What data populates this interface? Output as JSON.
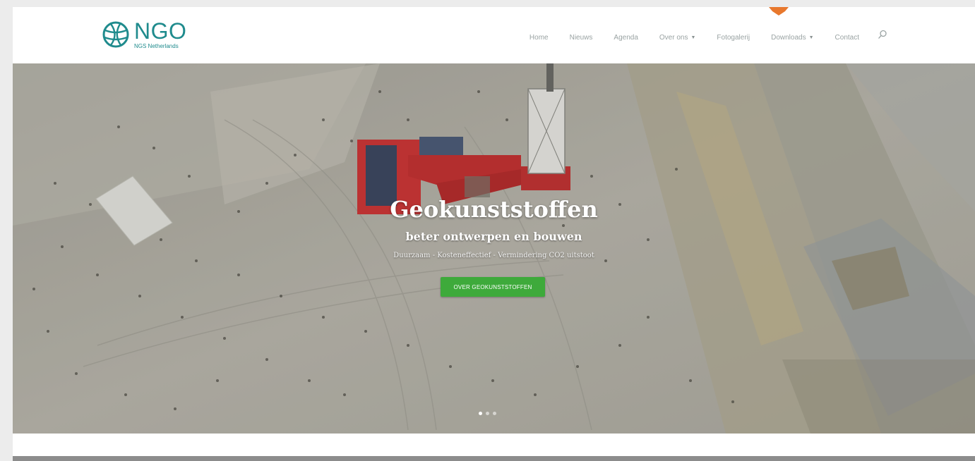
{
  "brand": {
    "name": "NGO",
    "subtitle": "NGS Netherlands",
    "color": "#1f8b8d"
  },
  "nav": {
    "items": [
      {
        "label": "Home",
        "dropdown": false
      },
      {
        "label": "Nieuws",
        "dropdown": false
      },
      {
        "label": "Agenda",
        "dropdown": false
      },
      {
        "label": "Over ons",
        "dropdown": true
      },
      {
        "label": "Fotogalerij",
        "dropdown": false
      },
      {
        "label": "Downloads",
        "dropdown": true
      },
      {
        "label": "Contact",
        "dropdown": false
      }
    ],
    "search_icon": "search-icon",
    "accent_tab_color": "#e8782d"
  },
  "hero": {
    "title": "Geokunststoffen",
    "subtitle": "beter ontwerpen en bouwen",
    "tagline": "Duurzaam - Kosteneffectief - Vermindering CO2 uitstoot",
    "cta_label": "OVER GEOKUNSTSTOFFEN",
    "cta_color": "#3eaa3b",
    "slides_count": 3,
    "active_slide": 1
  }
}
